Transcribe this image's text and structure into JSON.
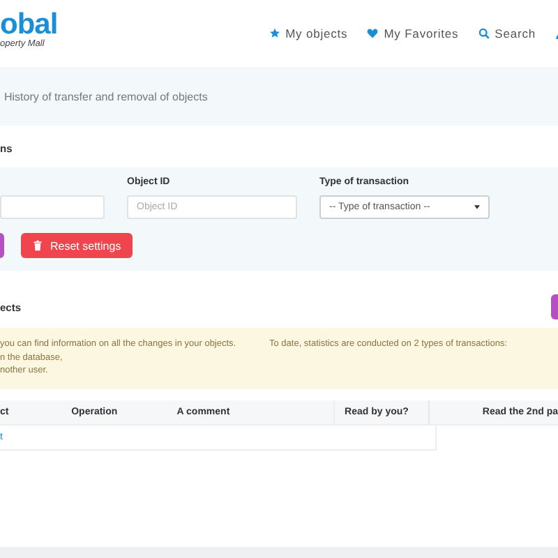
{
  "header": {
    "logo_text": "obal",
    "logo_subtitle": "operty Mall",
    "nav": [
      {
        "label": "My objects"
      },
      {
        "label": "My Favorites"
      },
      {
        "label": "Search"
      }
    ]
  },
  "breadcrumb": "History of transfer and removal of objects",
  "filters_title": "ns",
  "filters": [
    {
      "kind": "input"
    },
    {
      "label": "Object ID",
      "placeholder": "Object ID",
      "kind": "input"
    },
    {
      "label": "Type of transaction",
      "placeholder": "-- Type of transaction --",
      "kind": "select"
    }
  ],
  "reset_button": "Reset settings",
  "card_title": "ects",
  "alert": {
    "column_1": [
      "you can find information on all the changes in your objects.",
      "n the database,",
      "nother user."
    ],
    "column_2": "To date, statistics are conducted on 2 types of transactions:"
  },
  "table": {
    "columns": [
      "ct",
      "Operation",
      "A comment",
      "Read by you?",
      "Read the 2nd pa"
    ],
    "rows": [
      [
        "t",
        "",
        "",
        "",
        ""
      ]
    ]
  }
}
